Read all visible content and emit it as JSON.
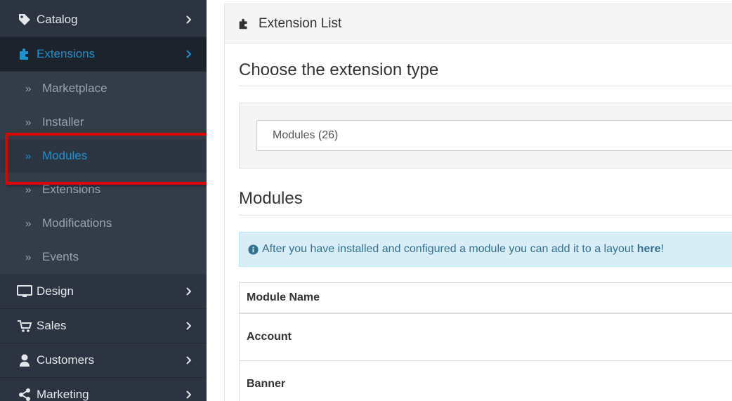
{
  "sidebar": {
    "items": [
      {
        "label": "Catalog",
        "icon": "tag-icon"
      },
      {
        "label": "Extensions",
        "icon": "puzzle-icon"
      },
      {
        "label": "Design",
        "icon": "monitor-icon"
      },
      {
        "label": "Sales",
        "icon": "cart-icon"
      },
      {
        "label": "Customers",
        "icon": "user-icon"
      },
      {
        "label": "Marketing",
        "icon": "share-icon"
      }
    ],
    "submenu": [
      {
        "label": "Marketplace"
      },
      {
        "label": "Installer"
      },
      {
        "label": "Modules"
      },
      {
        "label": "Extensions"
      },
      {
        "label": "Modifications"
      },
      {
        "label": "Events"
      }
    ],
    "colors": {
      "bg": "#2b3440",
      "active": "#1e91cf",
      "highlight": "#e00000"
    }
  },
  "panel": {
    "title": "Extension List",
    "choose_heading": "Choose the extension type",
    "select_value": "Modules (26)",
    "modules_heading": "Modules",
    "alert_text": "After you have installed and configured a module you can add it to a layout",
    "alert_link": "here",
    "alert_end": "!",
    "table": {
      "header": "Module Name",
      "rows": [
        "Account",
        "Banner"
      ]
    }
  }
}
